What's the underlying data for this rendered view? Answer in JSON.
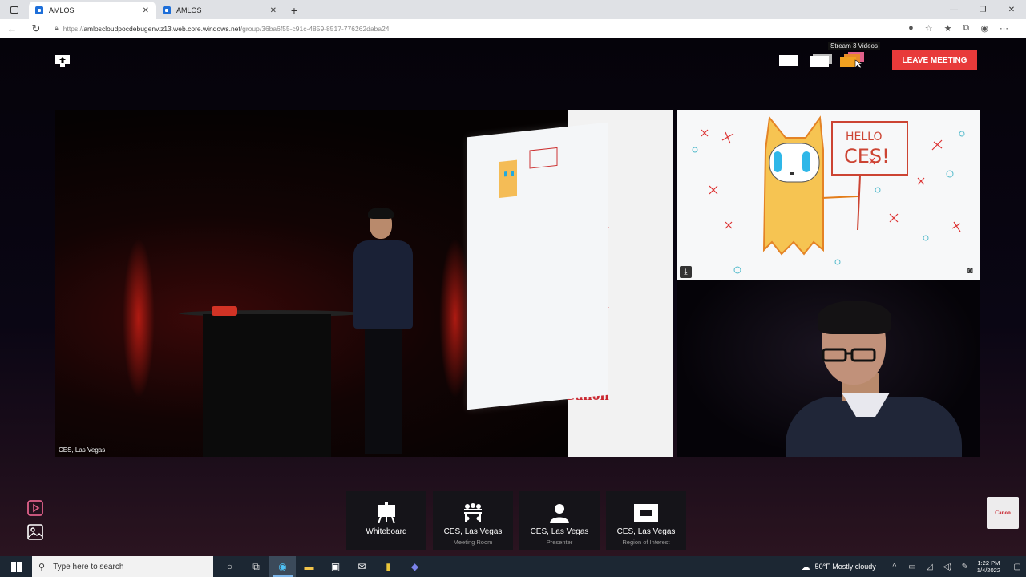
{
  "browser": {
    "tabs": [
      {
        "title": "AMLOS",
        "active": true
      },
      {
        "title": "AMLOS",
        "active": false
      }
    ],
    "url_prefix": "https://",
    "url_host": "amloscloudpocdebugenv.z13.web.core.windows.net",
    "url_path": "/group/36ba6f55-c91c-4859-8517-776262daba24"
  },
  "toolbar": {
    "tooltip": "Stream 3 Videos",
    "leave_label": "LEAVE MEETING",
    "leave_color": "#e83a3a"
  },
  "videos": {
    "main_label": "CES, Las Vegas",
    "whiteboard_text": "HELLO CES!"
  },
  "sources": [
    {
      "name": "Whiteboard",
      "sub": "",
      "icon": "whiteboard-icon"
    },
    {
      "name": "CES, Las Vegas",
      "sub": "Meeting Room",
      "icon": "meeting-room-icon"
    },
    {
      "name": "CES, Las Vegas",
      "sub": "Presenter",
      "icon": "presenter-icon"
    },
    {
      "name": "CES, Las Vegas",
      "sub": "Region of Interest",
      "icon": "region-of-interest-icon"
    }
  ],
  "taskbar": {
    "search_placeholder": "Type here to search",
    "weather": "50°F  Mostly cloudy",
    "time": "1:22 PM",
    "date": "1/4/2022"
  },
  "watermark": "Canon"
}
